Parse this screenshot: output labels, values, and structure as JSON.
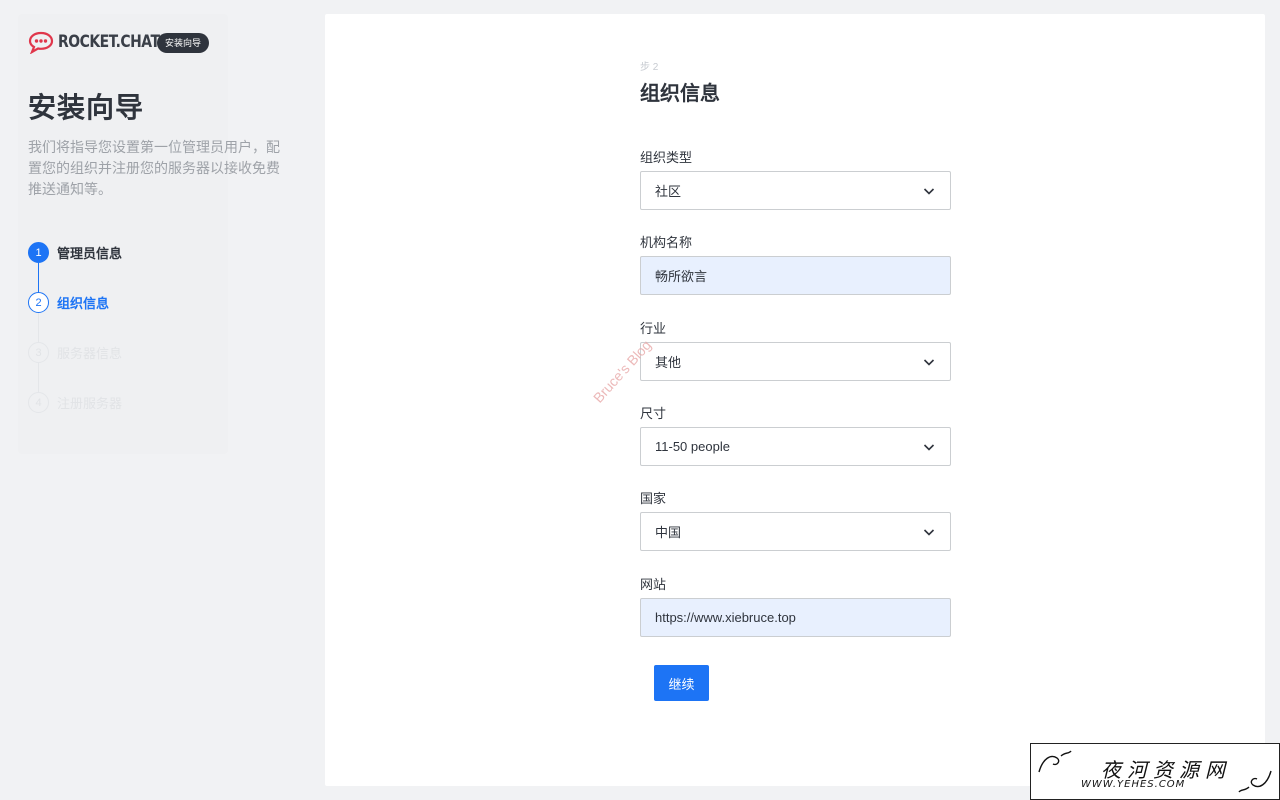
{
  "brand": {
    "name": "ROCKET.CHAT",
    "badge": "安装向导"
  },
  "sidebar": {
    "title": "安装向导",
    "description": "我们将指导您设置第一位管理员用户，配置您的组织并注册您的服务器以接收免费推送通知等。",
    "steps": [
      {
        "num": "1",
        "label": "管理员信息",
        "state": "done"
      },
      {
        "num": "2",
        "label": "组织信息",
        "state": "active"
      },
      {
        "num": "3",
        "label": "服务器信息",
        "state": "pending"
      },
      {
        "num": "4",
        "label": "注册服务器",
        "state": "pending"
      }
    ]
  },
  "form": {
    "step_indicator": "步 2",
    "title": "组织信息",
    "fields": {
      "org_type": {
        "label": "组织类型",
        "value": "社区"
      },
      "org_name": {
        "label": "机构名称",
        "value": "畅所欲言"
      },
      "industry": {
        "label": "行业",
        "value": "其他"
      },
      "size": {
        "label": "尺寸",
        "value": "11-50 people"
      },
      "country": {
        "label": "国家",
        "value": "中国"
      },
      "website": {
        "label": "网站",
        "value": "https://www.xiebruce.top"
      }
    },
    "continue_label": "继续"
  },
  "watermark": "Bruce's Blog",
  "stamp": {
    "text": "夜河资源网",
    "url": "WWW.YEHES.COM"
  },
  "colors": {
    "accent": "#1d74f5",
    "filled_field": "#e8f0fe",
    "brand_red": "#e0364b"
  }
}
